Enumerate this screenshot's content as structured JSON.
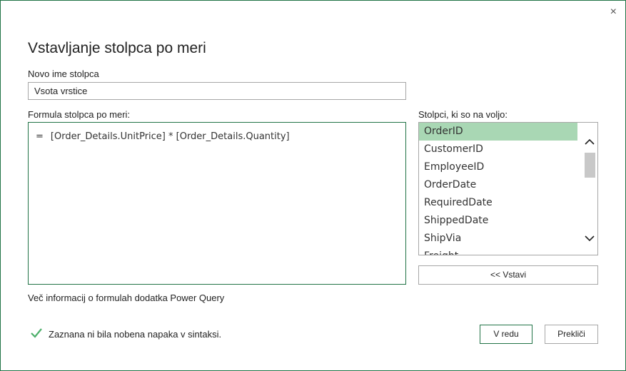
{
  "dialog": {
    "title": "Vstavljanje stolpca po meri",
    "close_symbol": "×",
    "new_column_label": "Novo ime stolpca",
    "new_column_value": "Vsota vrstice",
    "formula_label": "Formula stolpca po meri:",
    "formula_eq": "=",
    "formula_text": "[Order_Details.UnitPrice] * [Order_Details.Quantity]",
    "available_columns_label": "Stolpci, ki so na voljo:",
    "columns": [
      {
        "label": "OrderID",
        "selected": true
      },
      {
        "label": "CustomerID"
      },
      {
        "label": "EmployeeID"
      },
      {
        "label": "OrderDate"
      },
      {
        "label": "RequiredDate"
      },
      {
        "label": "ShippedDate"
      },
      {
        "label": "ShipVia"
      },
      {
        "label": "Freight"
      }
    ],
    "insert_button": "<< Vstavi",
    "info_link": "Več informacij o formulah dodatka Power Query",
    "status_text": "Zaznana ni bila nobena napaka v sintaksi.",
    "ok_button": "V redu",
    "cancel_button": "Prekliči",
    "colors": {
      "accent": "#217346",
      "selected": "#a9d7b4",
      "check": "#4caf6a"
    }
  }
}
